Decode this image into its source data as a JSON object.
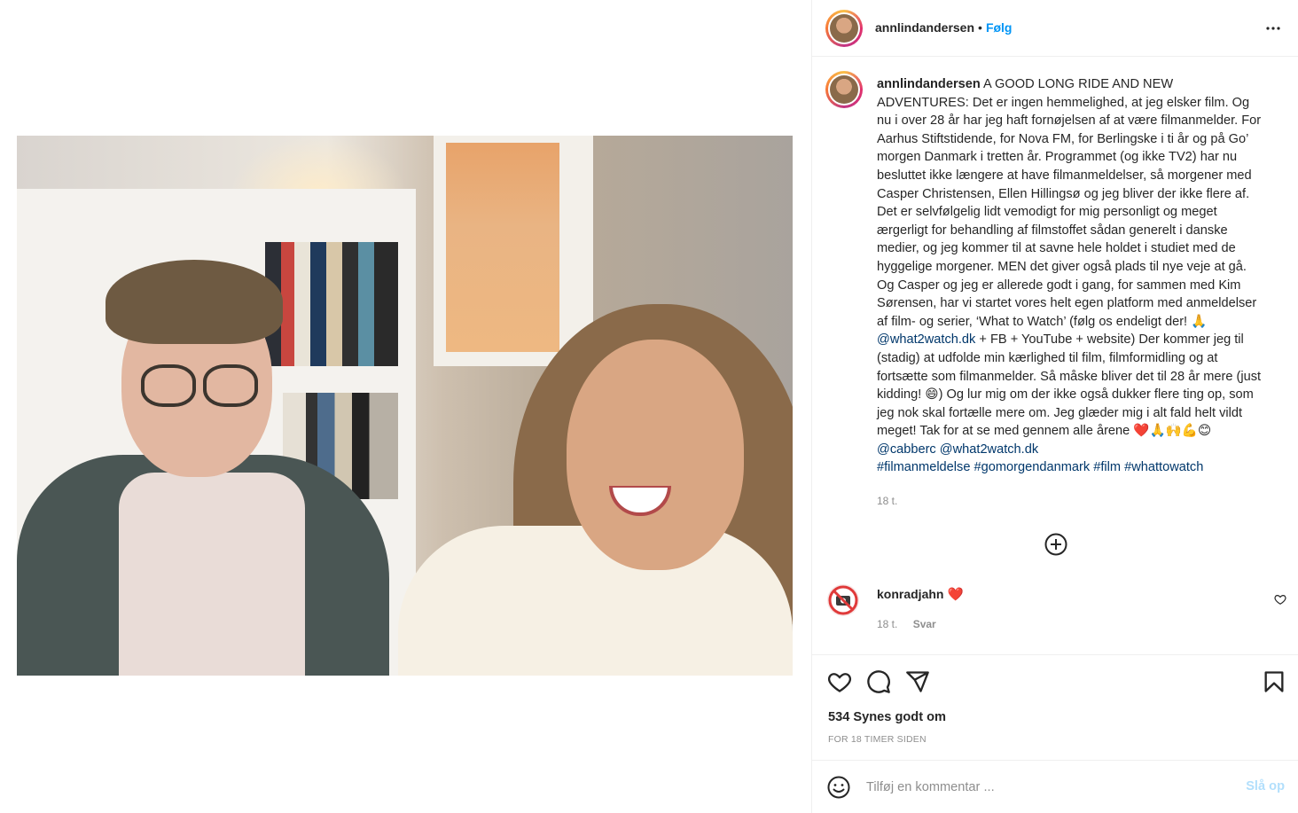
{
  "post": {
    "author": "annlindandersen",
    "follow_label": "Følg",
    "separator": "•",
    "caption_title": "A GOOD LONG RIDE AND NEW ADVENTURES:",
    "caption_p1": "Det er ingen hemmelighed, at jeg elsker film. Og nu i over 28 år har jeg haft fornøjelsen af at være filmanmelder. For Aarhus Stiftstidende, for Nova FM, for Berlingske i ti år og på Go’ morgen Danmark i tretten år. Programmet (og ikke TV2) har nu besluttet ikke længere at have filmanmeldelser, så morgener med Casper Christensen, Ellen Hillingsø og jeg bliver der ikke flere af. Det er selvfølgelig lidt vemodigt for mig personligt og meget ærgerligt for behandling af filmstoffet sådan generelt i danske medier, og jeg kommer til at savne hele holdet i studiet med de hyggelige morgener. MEN det giver også plads til nye veje at gå. Og Casper og jeg er allerede godt i gang, for sammen med Kim Sørensen, har vi startet vores helt egen platform med anmeldelser af film- og serier, ‘What to Watch’ (følg os endeligt der! 🙏",
    "mention_what2watch": "@what2watch.dk",
    "caption_p2": "+ FB + YouTube + website) Der kommer jeg til (stadig) at udfolde min kærlighed til film, filmformidling og at fortsætte som filmanmelder. Så måske bliver det til 28 år mere (just kidding! 😄) Og lur mig om der ikke også dukker flere ting op, som jeg nok skal fortælle mere om. Jeg glæder mig i alt fald helt vildt meget! Tak for at se med gennem alle årene ❤️🙏🙌💪😊",
    "mention_cabberc": "@cabberc",
    "mention_what2watch_2": "@what2watch.dk",
    "hashtags": [
      "#filmanmeldelse",
      "#gomorgendanmark",
      "#film",
      "#whattowatch"
    ],
    "caption_time": "18 t.",
    "likes": "534 Synes godt om",
    "time_ago": "FOR 18 TIMER SIDEN"
  },
  "comment": {
    "user": "konradjahn",
    "text": "❤️",
    "time": "18 t.",
    "reply_label": "Svar"
  },
  "comment_box": {
    "placeholder": "Tilføj en kommentar ...",
    "post_label": "Slå op"
  },
  "icons": {
    "more": "more-options-icon",
    "load_more": "plus-circle-icon",
    "like": "heart-icon",
    "comment": "comment-bubble-icon",
    "share": "paper-plane-icon",
    "save": "bookmark-icon",
    "emoji": "smiley-icon"
  },
  "colors": {
    "follow": "#0095f6",
    "link": "#00376b",
    "muted": "#8e8e8e",
    "post_disabled": "#b2dffc"
  }
}
